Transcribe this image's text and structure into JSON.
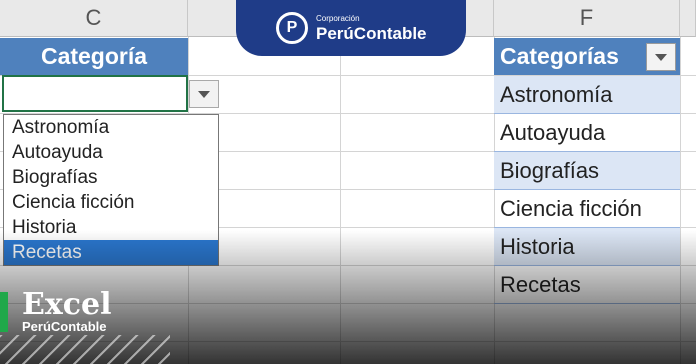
{
  "columns": {
    "c": "C",
    "f": "F"
  },
  "left_header": "Categoría",
  "right_header": "Categorías",
  "dropdown_options": [
    "Astronomía",
    "Autoayuda",
    "Biografías",
    "Ciencia ficción",
    "Historia",
    "Recetas"
  ],
  "selected_option_index": 5,
  "table_values": [
    "Astronomía",
    "Autoayuda",
    "Biografías",
    "Ciencia ficción",
    "Historia",
    "Recetas"
  ],
  "logo": {
    "small": "Corporación",
    "big": "PerúContable",
    "mark": "P"
  },
  "badge": {
    "title": "Excel",
    "subtitle": "PerúContable"
  },
  "colors": {
    "header_blue": "#4f81bd",
    "band_blue": "#dce6f5",
    "selection_blue": "#2b78d0",
    "logo_navy": "#1f3c88",
    "accent_green": "#20a84a"
  },
  "icons": [
    "dropdown-arrow-icon",
    "filter-arrow-icon",
    "logo-mark-icon"
  ]
}
